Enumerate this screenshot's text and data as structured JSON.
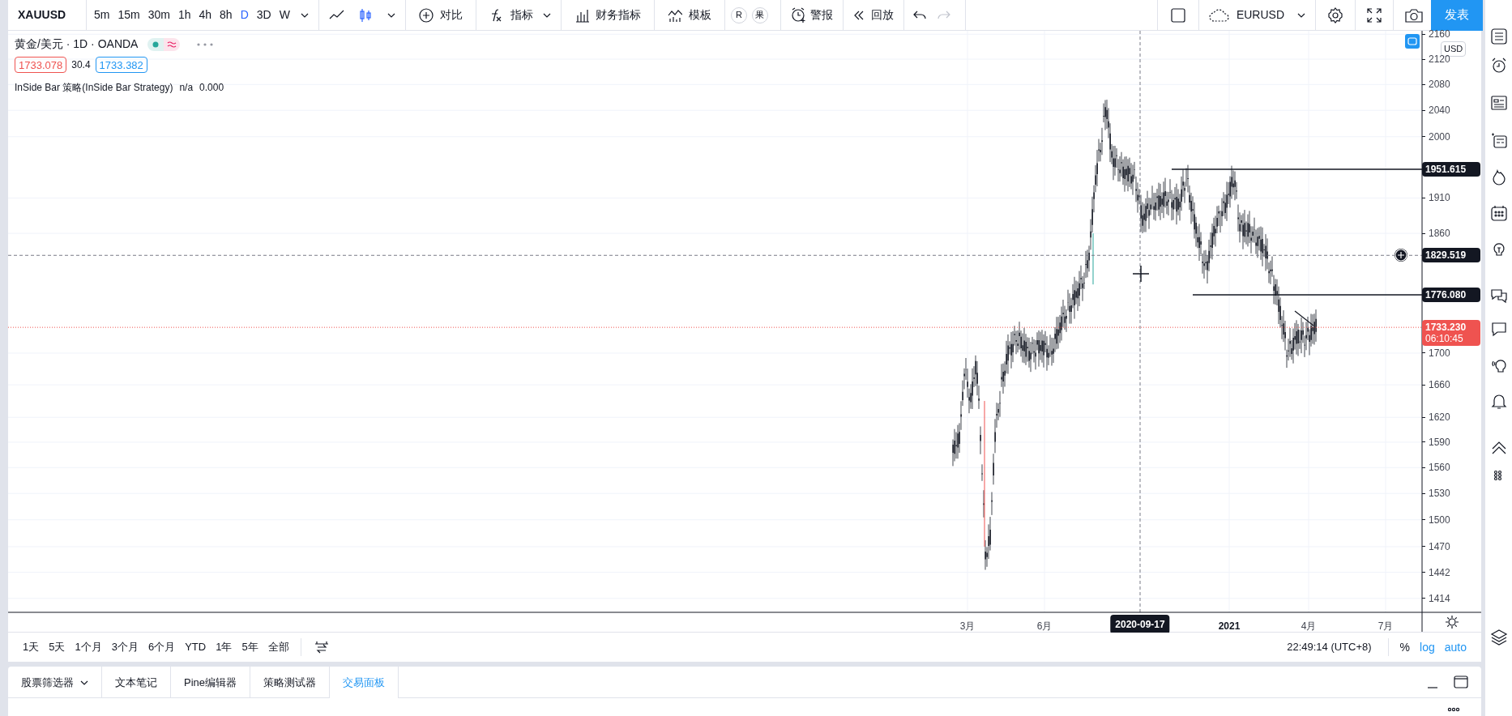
{
  "toolbar": {
    "symbol": "XAUUSD",
    "intervals": [
      {
        "label": "5m",
        "selected": false
      },
      {
        "label": "15m",
        "selected": false
      },
      {
        "label": "30m",
        "selected": false
      },
      {
        "label": "1h",
        "selected": false
      },
      {
        "label": "4h",
        "selected": false
      },
      {
        "label": "8h",
        "selected": false
      },
      {
        "label": "D",
        "selected": true
      },
      {
        "label": "3D",
        "selected": false
      },
      {
        "label": "W",
        "selected": false
      }
    ],
    "chart_types": [
      {
        "kind": "line",
        "selected": false
      },
      {
        "kind": "candles",
        "selected": true
      }
    ],
    "buttons": [
      {
        "kind": "compare",
        "label": "对比"
      },
      {
        "kind": "indicators",
        "label": "指标"
      },
      {
        "kind": "financials",
        "label": "财务指标"
      },
      {
        "kind": "templates",
        "label": "模板"
      }
    ],
    "badges": [
      "R",
      "果"
    ],
    "alert": "警报",
    "replay": "回放",
    "history": [
      {
        "kind": "undo",
        "disabled": false
      },
      {
        "kind": "redo",
        "disabled": true
      }
    ],
    "compare_symbol": "EURUSD",
    "publish": "发表"
  },
  "legend": {
    "title": "黄金/美元 · 1D · OANDA",
    "bid": "1733.078",
    "spread": "30.4",
    "ask": "1733.382",
    "indicator": "InSide Bar 策略(InSide Bar Strategy)",
    "indicator_values": [
      "n/a",
      "0.000"
    ]
  },
  "price_axis": {
    "currency": "USD",
    "ticks": [
      "2160",
      "2120",
      "2080",
      "2040",
      "2000",
      "1910",
      "1860",
      "1700",
      "1660",
      "1620",
      "1590",
      "1560",
      "1530",
      "1500",
      "1470",
      "1442",
      "1414"
    ],
    "markers": [
      {
        "kind": "line",
        "label": "1951.615"
      },
      {
        "kind": "crosshair",
        "label": "1829.519"
      },
      {
        "kind": "line",
        "label": "1776.080"
      },
      {
        "kind": "last",
        "label": "1733.230",
        "countdown": "06:10:45"
      }
    ]
  },
  "time_axis": {
    "ticks": [
      "3月",
      "6月",
      "2021",
      "4月",
      "7月"
    ],
    "crosshair": "2020-09-17"
  },
  "range_bar": {
    "ranges": [
      "1天",
      "5天",
      "1个月",
      "3个月",
      "6个月",
      "YTD",
      "1年",
      "5年",
      "全部"
    ],
    "clock": "22:49:14 (UTC+8)",
    "scale_options": [
      {
        "label": "%",
        "on": false
      },
      {
        "label": "log",
        "on": true
      },
      {
        "label": "auto",
        "on": true
      }
    ]
  },
  "bottom_tabs": [
    {
      "label": "股票筛选器",
      "selected": false,
      "dropdown": true
    },
    {
      "label": "文本笔记",
      "selected": false,
      "dropdown": false
    },
    {
      "label": "Pine编辑器",
      "selected": false,
      "dropdown": false
    },
    {
      "label": "策略测试器",
      "selected": false,
      "dropdown": false
    },
    {
      "label": "交易面板",
      "selected": true,
      "dropdown": false
    }
  ]
}
